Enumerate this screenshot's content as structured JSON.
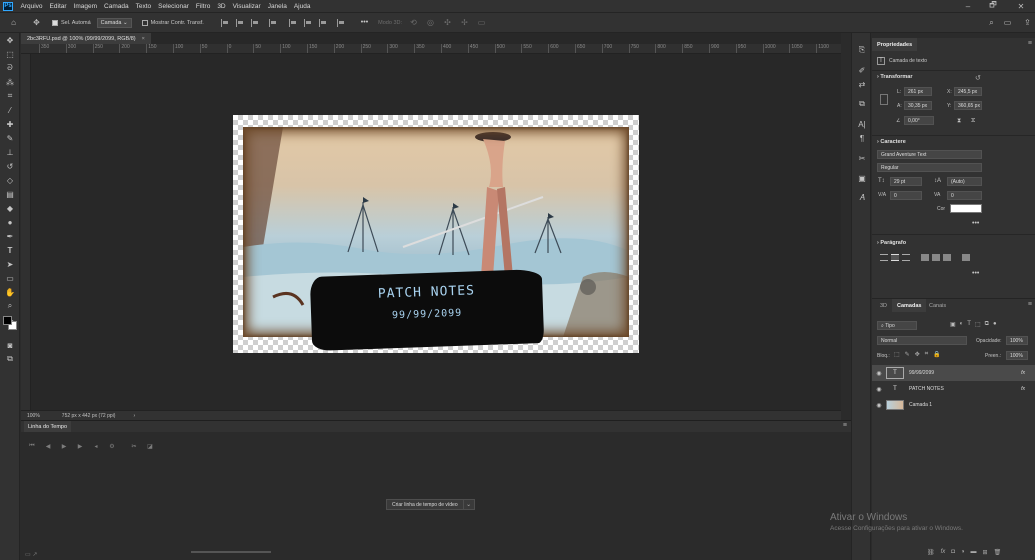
{
  "menubar": {
    "logo": "Ps",
    "items": [
      "Arquivo",
      "Editar",
      "Imagem",
      "Camada",
      "Texto",
      "Selecionar",
      "Filtro",
      "3D",
      "Visualizar",
      "Janela",
      "Ajuda"
    ],
    "window_controls": [
      "–",
      "🗗",
      "✕"
    ]
  },
  "options": {
    "auto_select_label": "Sel. Automá",
    "auto_select_target": "Camada",
    "show_transform_label": "Mostrar Contr. Transf.",
    "more_label": "•••",
    "mode_3d_label": "Modo 3D:"
  },
  "document": {
    "tab_title": "2bc3RFU.psd @ 100% (99/99/2099, RGB/8)",
    "close_symbol": "×"
  },
  "ruler": {
    "ticks": [
      "350",
      "300",
      "250",
      "200",
      "150",
      "100",
      "50",
      "0",
      "50",
      "100",
      "150",
      "200",
      "250",
      "300",
      "350",
      "400",
      "450",
      "500",
      "550",
      "600",
      "650",
      "700",
      "750",
      "800",
      "850",
      "900",
      "950",
      "1000",
      "1050",
      "1100"
    ]
  },
  "canvas": {
    "title_text": "PATCH NOTES",
    "date_text": "99/99/2099"
  },
  "status": {
    "zoom": "100%",
    "doc_info": "752 px x 442 px (72 ppi)",
    "arrow": "›"
  },
  "properties": {
    "tab_label": "Propriedades",
    "layer_type": "Camada de texto",
    "transform_title": "Transformar",
    "w_label": "L:",
    "w_value": "261 px",
    "h_label": "A:",
    "h_value": "30,35 px",
    "x_label": "X:",
    "x_value": "245,5 px",
    "y_label": "Y:",
    "y_value": "360,65 px",
    "angle_label": "∠",
    "angle_value": "0,00°",
    "character_title": "Caractere",
    "font_family": "Grand Aventure Text",
    "font_style": "Regular",
    "font_size": "29 pt",
    "leading": "(Auto)",
    "kerning": "0",
    "tracking": "0",
    "color_label": "Cor",
    "more": "•••",
    "paragraph_title": "Parágrafo"
  },
  "layers": {
    "tabs": [
      "3D",
      "Camadas",
      "Canais"
    ],
    "active_tab": "Camadas",
    "filter_label": "Tipo",
    "blend_mode": "Normal",
    "opacity_label": "Opacidade:",
    "opacity_value": "100%",
    "lock_label": "Bloq.:",
    "fill_label": "Preen.:",
    "fill_value": "100%",
    "items": [
      {
        "name": "99/99/2099",
        "type": "text",
        "fx": "fx"
      },
      {
        "name": "PATCH NOTES",
        "type": "text",
        "fx": "fx"
      },
      {
        "name": "Camada 1",
        "type": "image",
        "fx": ""
      }
    ]
  },
  "timeline": {
    "tab_label": "Linha do Tempo",
    "create_button": "Criar linha de tempo de vídeo"
  },
  "watermark": {
    "title": "Ativar o Windows",
    "subtitle": "Acesse Configurações para ativar o Windows."
  },
  "colors": {
    "accent": "#31a8ff",
    "canvas_text": "#a9d3f0",
    "panel_bg": "#323232"
  }
}
